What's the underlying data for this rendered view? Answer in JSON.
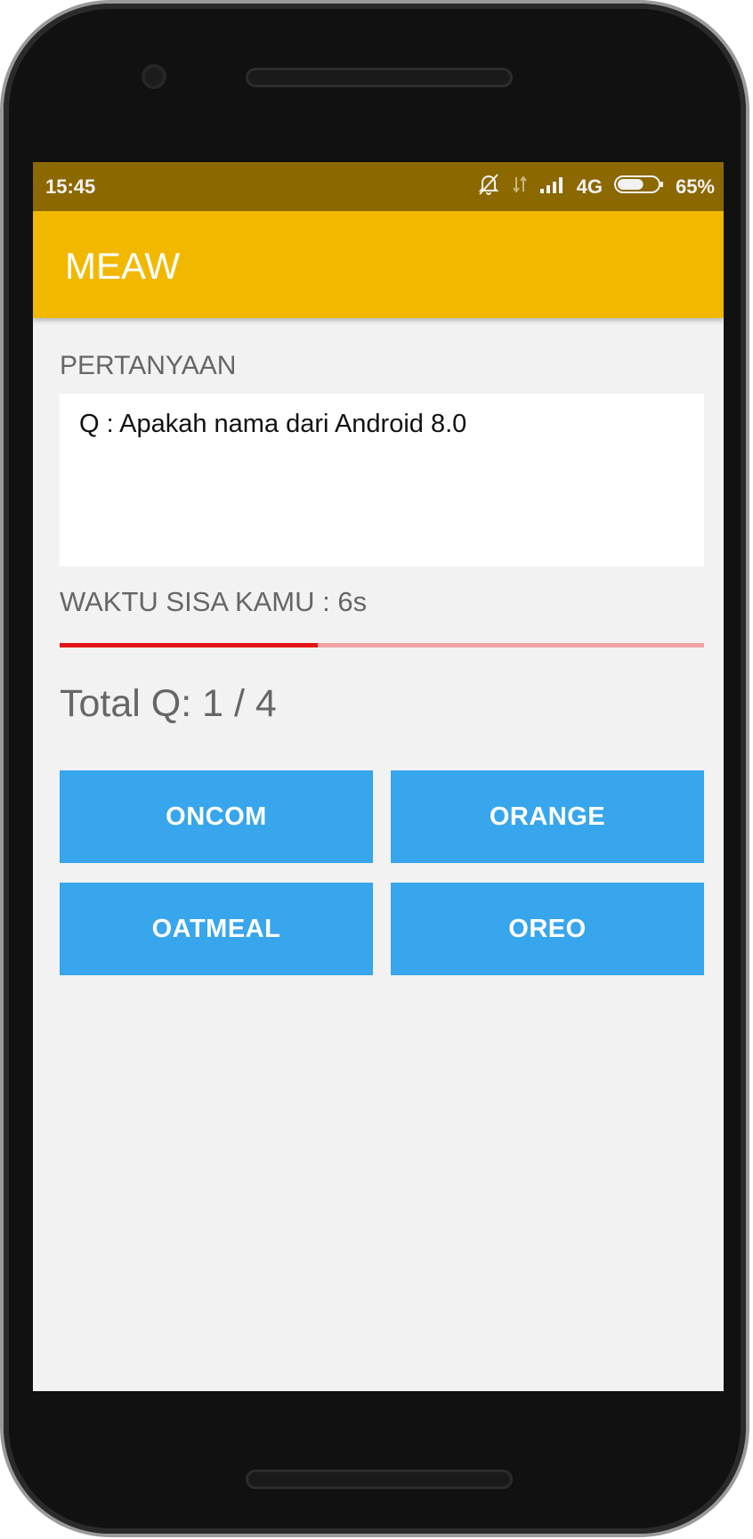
{
  "status_bar": {
    "time": "15:45",
    "network": "4G",
    "battery_percent": "65%",
    "battery_level": 0.65,
    "icons": [
      "mute-bell-icon",
      "data-arrows-icon",
      "signal-icon",
      "battery-icon"
    ]
  },
  "app_bar": {
    "title": "MEAW",
    "color": "#f2b800"
  },
  "quiz": {
    "question_label": "PERTANYAAN",
    "question": "Q : Apakah nama dari Android 8.0",
    "timer_label": "WAKTU SISA KAMU : 6s",
    "time_remaining_fraction": 0.4,
    "total": "Total Q: 1 / 4"
  },
  "answers": [
    "ONCOM",
    "ORANGE",
    "OATMEAL",
    "OREO"
  ],
  "colors": {
    "status_bar": "#8c6800",
    "button": "#37a6ec",
    "progress": "#e41414",
    "progress_track": "#f2a2a2",
    "background": "#f2f2f2"
  }
}
